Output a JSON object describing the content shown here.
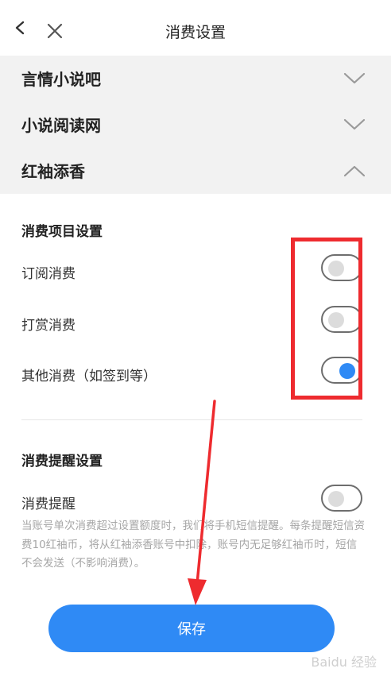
{
  "header": {
    "title": "消费设置"
  },
  "accordion": {
    "items": [
      {
        "label": "言情小说吧",
        "expanded": false
      },
      {
        "label": "小说阅读网",
        "expanded": false
      },
      {
        "label": "红袖添香",
        "expanded": true
      }
    ]
  },
  "consumption_items": {
    "title": "消费项目设置",
    "rows": [
      {
        "label": "订阅消费",
        "enabled": false
      },
      {
        "label": "打赏消费",
        "enabled": false
      },
      {
        "label": "其他消费（如签到等）",
        "enabled": true
      }
    ]
  },
  "reminder": {
    "title": "消费提醒设置",
    "row_label": "消费提醒",
    "enabled": false,
    "note": "当账号单次消费超过设置额度时，我们将手机短信提醒。每条提醒短信资费10红袖币，将从红袖添香账号中扣除，账号内无足够红袖币时，短信不会发送（不影响消费）。"
  },
  "footer": {
    "save_label": "保存"
  },
  "watermark": "Baidu 经验",
  "colors": {
    "accent": "#2f8af5",
    "annotation": "#ee2b2f"
  }
}
